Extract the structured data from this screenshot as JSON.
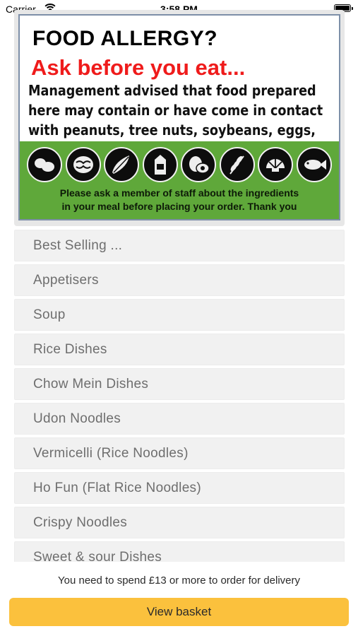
{
  "status_bar": {
    "carrier": "Carrier",
    "time": "3:58 PM"
  },
  "allergy_banner": {
    "title": "FOOD ALLERGY?",
    "subtitle": "Ask before you eat...",
    "text": "Management advised that food prepared here may contain or have come in contact with peanuts, tree nuts, soybeans, eggs, wheat, shellfish or fish",
    "note_line1": "Please ask a member of staff about the ingredients",
    "note_line2": "in your meal before placing your order. Thank you",
    "icons": [
      "peanut-icon",
      "walnut-icon",
      "soybean-icon",
      "milk-carton-icon",
      "egg-icon",
      "wheat-icon",
      "shellfish-icon",
      "fish-icon"
    ],
    "strip_color": "#5fa83a",
    "subtitle_color": "#ef1b1b"
  },
  "categories": [
    "Best Selling ...",
    "Appetisers",
    "Soup",
    "Rice Dishes",
    "Chow Mein Dishes",
    "Udon Noodles",
    "Vermicelli (Rice Noodles)",
    "Ho Fun (Flat Rice Noodles)",
    "Crispy Noodles",
    "Sweet & sour Dishes"
  ],
  "footer": {
    "delivery_note": "You need to spend £13 or more to order for delivery",
    "basket_label": "View basket",
    "accent_color": "#fbc13d"
  }
}
